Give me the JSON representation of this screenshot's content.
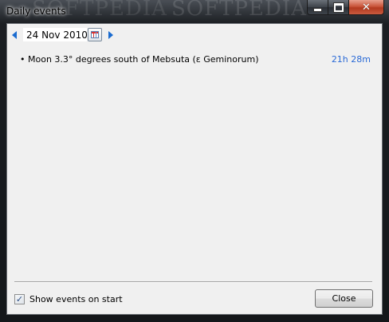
{
  "window": {
    "title": "Daily events",
    "watermark": "SOFTPEDIA"
  },
  "toolbar": {
    "date": "24 Nov 2010"
  },
  "events": [
    {
      "text": "Moon 3.3° degrees south of Mebsuta (ε Geminorum)",
      "time": "21h 28m",
      "bullet": "•"
    }
  ],
  "footer": {
    "show_on_start_label": "Show events on start",
    "show_on_start_checked": true,
    "check_mark": "✓",
    "close_label": "Close"
  },
  "icons": {
    "close_glyph": "✕"
  },
  "colors": {
    "accent": "#1a6bd0",
    "time_text": "#2a6ad6",
    "close_button": "#c9553a"
  }
}
